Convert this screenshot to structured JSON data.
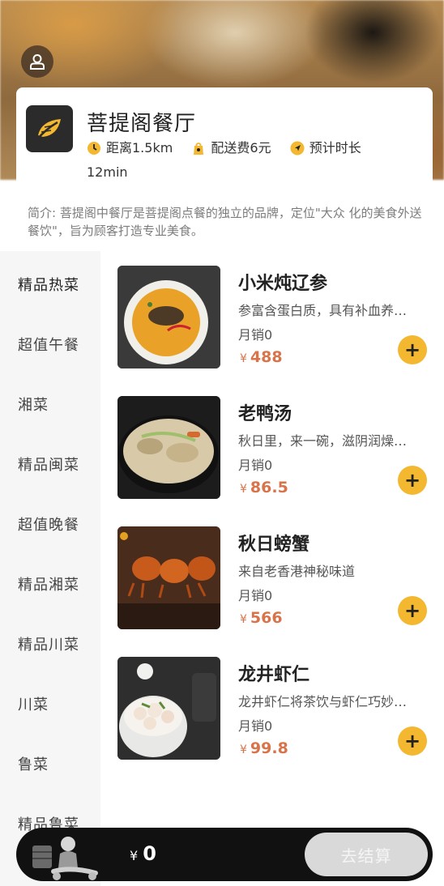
{
  "restaurant": {
    "name": "菩提阁餐厅",
    "distance": "距离1.5km",
    "delivery_fee": "配送费6元",
    "eta_label": "预计时长",
    "eta_value": "12min",
    "intro": "简介: 菩提阁中餐厅是菩提阁点餐的独立的品牌，定位\"大众 化的美食外送餐饮\"，旨为顾客打造专业美食。"
  },
  "categories": [
    "精品热菜",
    "超值午餐",
    "湘菜",
    "精品闽菜",
    "超值晚餐",
    "精品湘菜",
    "精品川菜",
    "川菜",
    "鲁菜",
    "精品鲁菜"
  ],
  "dishes": [
    {
      "name": "小米炖辽参",
      "desc": "参富含蛋白质，具有补血养颜之功效",
      "sales": "月销0",
      "currency": "¥",
      "price": "488"
    },
    {
      "name": "老鸭汤",
      "desc": "秋日里，来一碗，滋阴润燥好味道",
      "sales": "月销0",
      "currency": "¥",
      "price": "86.5"
    },
    {
      "name": "秋日螃蟹",
      "desc": "来自老香港神秘味道",
      "sales": "月销0",
      "currency": "¥",
      "price": "566"
    },
    {
      "name": "龙井虾仁",
      "desc": "龙井虾仁将茶饮与虾仁巧妙结合",
      "sales": "月销0",
      "currency": "¥",
      "price": "99.8"
    }
  ],
  "cart": {
    "currency": "¥",
    "total": "0",
    "checkout_label": "去结算"
  },
  "colors": {
    "accent": "#f3b730",
    "price": "#d9734a",
    "cart_bar": "#111111"
  },
  "icons": {
    "avatar": "user-icon",
    "logo": "leaf-icon",
    "distance": "clock-icon",
    "delivery": "bag-icon",
    "eta": "navigation-icon",
    "add": "plus-icon",
    "cart": "cart-icon"
  }
}
